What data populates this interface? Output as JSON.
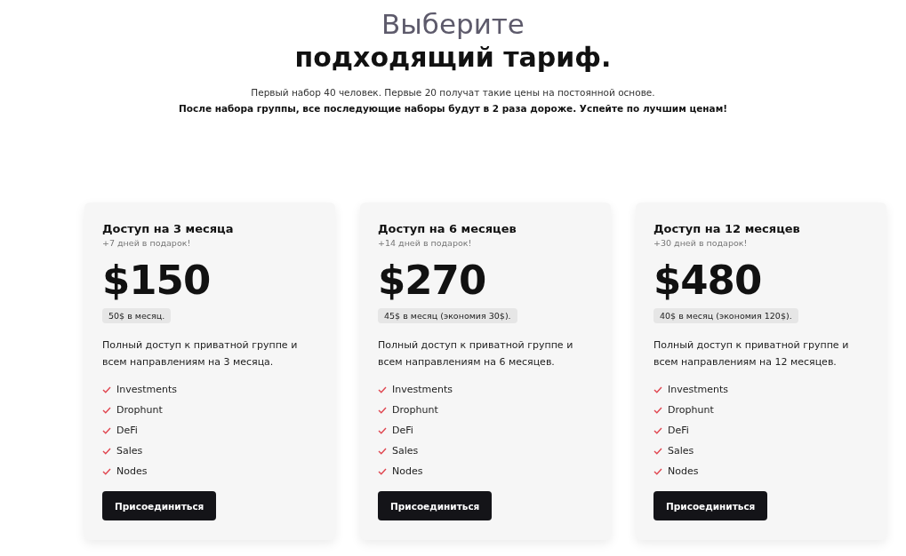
{
  "header": {
    "title_line_1": "Выберите",
    "title_line_2": "подходящий тариф.",
    "note": "Первый набор 40 человек. Первые 20 получат такие цены на постоянной основе.",
    "warning": "После набора группы, все последующие наборы будут в 2 раза дороже. Успейте по лучшим ценам!"
  },
  "plans": [
    {
      "name": "Доступ на 3 месяца",
      "bonus": "+7 дней в подарок!",
      "price": "$150",
      "monthly": "50$ в месяц.",
      "description": "Полный доступ к приватной группе и всем направлениям на 3 месяца.",
      "features": [
        "Investments",
        "Drophunt",
        "DeFi",
        "Sales",
        "Nodes"
      ],
      "button": "Присоединиться"
    },
    {
      "name": "Доступ на 6 месяцев",
      "bonus": "+14 дней в подарок!",
      "price": "$270",
      "monthly": "45$ в месяц (экономия 30$).",
      "description": "Полный доступ к приватной группе и всем направлениям на 6 месяцев.",
      "features": [
        "Investments",
        "Drophunt",
        "DeFi",
        "Sales",
        "Nodes"
      ],
      "button": "Присоединиться"
    },
    {
      "name": "Доступ на 12 месяцев",
      "bonus": "+30 дней в подарок!",
      "price": "$480",
      "monthly": "40$ в месяц (экономия 120$).",
      "description": "Полный доступ к приватной группе и всем направлениям на 12 месяцев.",
      "features": [
        "Investments",
        "Drophunt",
        "DeFi",
        "Sales",
        "Nodes"
      ],
      "button": "Присоединиться"
    }
  ]
}
